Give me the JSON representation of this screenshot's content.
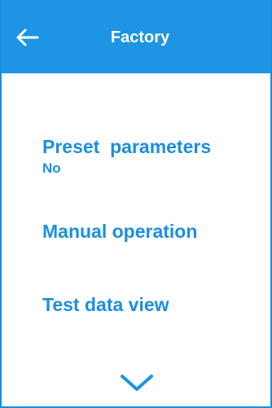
{
  "header": {
    "title": "Factory",
    "back_icon": "arrow-left-icon"
  },
  "menu": {
    "items": [
      {
        "label": "Preset  parameters",
        "value": "No"
      },
      {
        "label": "Manual operation"
      },
      {
        "label": "Test data view"
      }
    ]
  },
  "footer": {
    "scroll_icon": "chevron-down-icon"
  },
  "colors": {
    "accent": "#1d94e4",
    "text_accent": "#1b8fdf",
    "background": "#ffffff"
  }
}
